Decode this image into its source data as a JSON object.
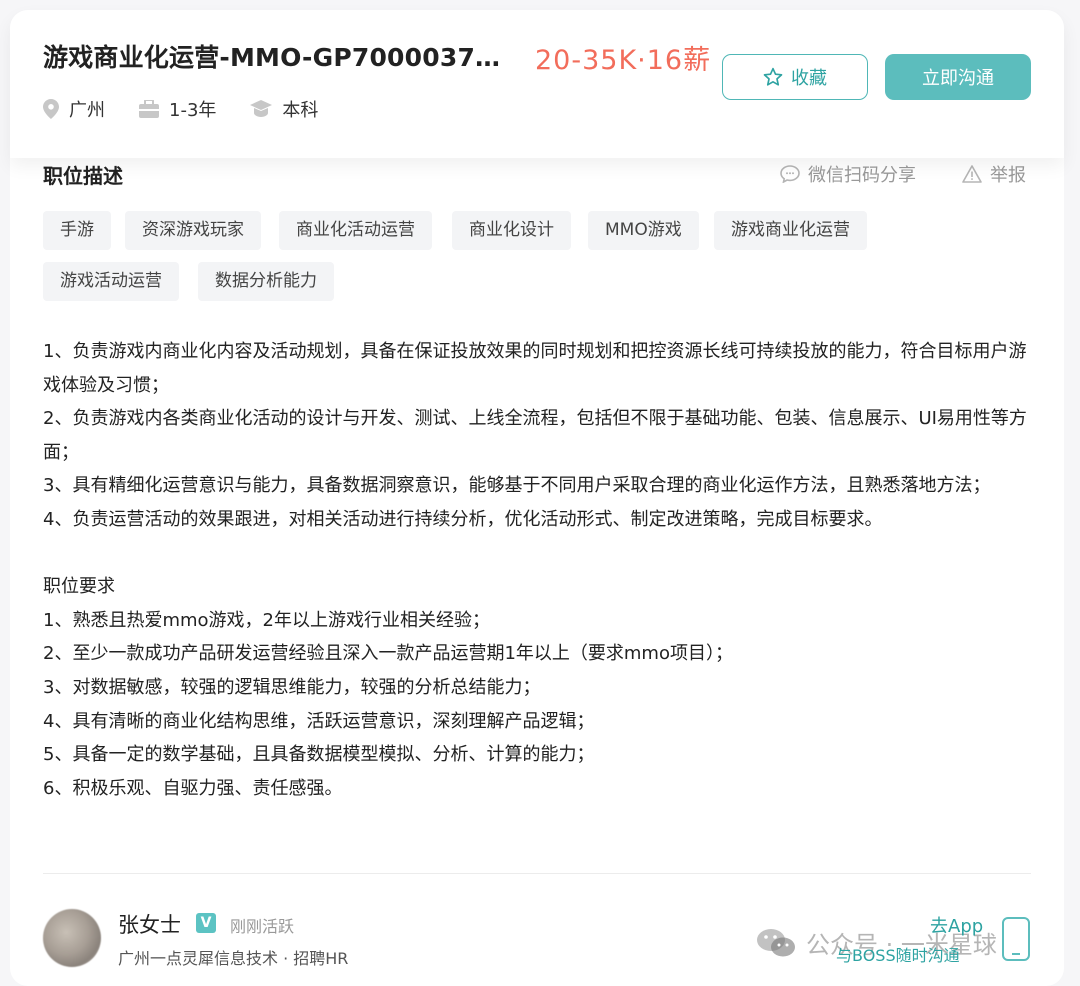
{
  "job": {
    "title": "游戏商业化运营-MMO-GP7000037…",
    "salary": "20-35K·16薪",
    "location": "广州",
    "experience": "1-3年",
    "education": "本科"
  },
  "actions": {
    "favorite_label": "收藏",
    "chat_label": "立即沟通"
  },
  "section": {
    "title": "职位描述",
    "share_label": "微信扫码分享",
    "report_label": "举报"
  },
  "tags": [
    "手游",
    "资深游戏玩家",
    "商业化活动运营",
    "商业化设计",
    "MMO游戏",
    "游戏商业化运营",
    "游戏活动运营",
    "数据分析能力"
  ],
  "description": {
    "duties": [
      "1、负责游戏内商业化内容及活动规划，具备在保证投放效果的同时规划和把控资源长线可持续投放的能力，符合目标用户游戏体验及习惯；",
      "2、负责游戏内各类商业化活动的设计与开发、测试、上线全流程，包括但不限于基础功能、包装、信息展示、UI易用性等方面；",
      "3、具有精细化运营意识与能力，具备数据洞察意识，能够基于不同用户采取合理的商业化运作方法，且熟悉落地方法；",
      "4、负责运营活动的效果跟进，对相关活动进行持续分析，优化活动形式、制定改进策略，完成目标要求。"
    ],
    "requirements_title": "职位要求",
    "requirements": [
      "1、熟悉且热爱mmo游戏，2年以上游戏行业相关经验；",
      "2、至少一款成功产品研发运营经验且深入一款产品运营期1年以上（要求mmo项目）；",
      "3、对数据敏感，较强的逻辑思维能力，较强的分析总结能力；",
      "4、具有清晰的商业化结构思维，活跃运营意识，深刻理解产品逻辑；",
      "5、具备一定的数学基础，且具备数据模型模拟、分析、计算的能力；",
      "6、积极乐观、自驱力强、责任感强。"
    ]
  },
  "recruiter": {
    "name": "张女士",
    "verified_badge": "V",
    "status": "刚刚活跃",
    "company": "广州一点灵犀信息技术 · 招聘HR"
  },
  "footer": {
    "watermark": "公众号 · 一米星球",
    "go_app": "去App",
    "boss_chat": "与BOSS随时沟通"
  },
  "colors": {
    "accent": "#5cbdbd",
    "salary": "#f26d5b",
    "tag_bg": "#f3f4f6"
  }
}
